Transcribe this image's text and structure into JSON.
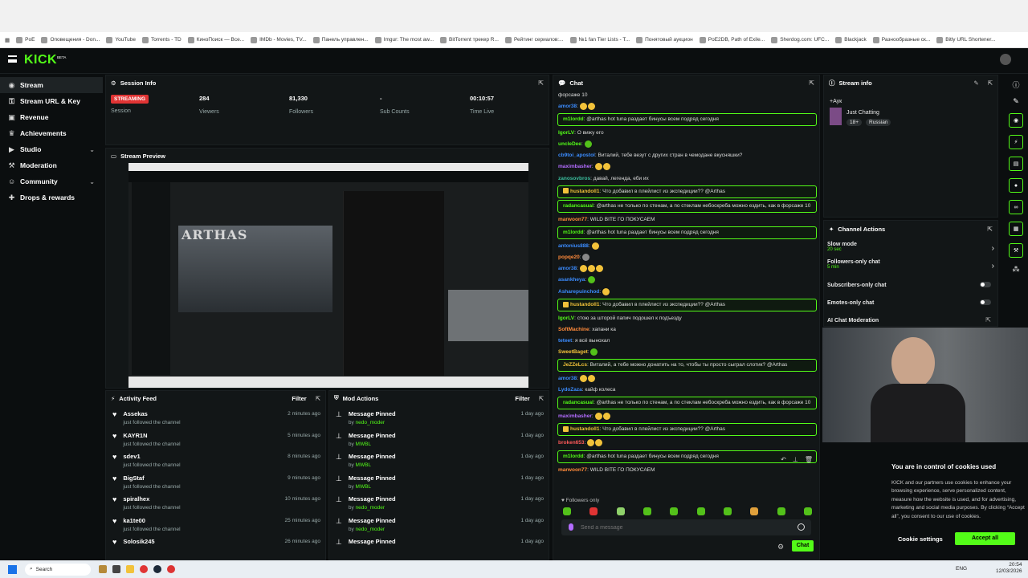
{
  "bookmarks": [
    "PoE",
    "Оповещения - Don...",
    "YouTube",
    "Torrents - TD",
    "КиноПоиск — Все...",
    "IMDb - Movies, TV...",
    "Панель управлен...",
    "Imgur: The most aw...",
    "BitTorrent трекер R...",
    "Рейтинг сериалов:...",
    "№1 fan Tier Lists - T...",
    "Понятовый аукцион",
    "PoE2DB, Path of Exile...",
    "Sherdog.com: UFC...",
    "Blackjack",
    "Разнообразные ск...",
    "Bitly URL Shortener..."
  ],
  "brand": {
    "logo": "KICK",
    "beta": "BETA",
    "accent": "#53fc18"
  },
  "sidebar": {
    "items": [
      {
        "label": "Stream",
        "icon": "broadcast-icon"
      },
      {
        "label": "Stream URL & Key",
        "icon": "key-icon"
      },
      {
        "label": "Revenue",
        "icon": "wallet-icon"
      },
      {
        "label": "Achievements",
        "icon": "trophy-icon"
      },
      {
        "label": "Studio",
        "icon": "studio-icon"
      },
      {
        "label": "Moderation",
        "icon": "wrench-icon"
      },
      {
        "label": "Community",
        "icon": "people-icon"
      },
      {
        "label": "Drops & rewards",
        "icon": "gift-icon"
      }
    ]
  },
  "session": {
    "title": "Session Info",
    "status": "STREAMING",
    "session_label": "Session",
    "viewers": "284",
    "viewers_label": "Viewers",
    "followers": "81,330",
    "followers_label": "Followers",
    "subs": "-",
    "subs_label": "Sub Counts",
    "time": "00:10:57",
    "time_label": "Time Live"
  },
  "preview": {
    "title": "Stream Preview",
    "overlay_text": "ARTHAS"
  },
  "activity": {
    "title": "Activity Feed",
    "filter": "Filter",
    "rows": [
      {
        "name": "Assekas",
        "sub": "just followed the channel",
        "time": "2 minutes ago"
      },
      {
        "name": "KAYR1N",
        "sub": "just followed the channel",
        "time": "5 minutes ago"
      },
      {
        "name": "sdev1",
        "sub": "just followed the channel",
        "time": "8 minutes ago"
      },
      {
        "name": "BigStaf",
        "sub": "just followed the channel",
        "time": "9 minutes ago"
      },
      {
        "name": "spiralhex",
        "sub": "just followed the channel",
        "time": "10 minutes ago"
      },
      {
        "name": "ka1te00",
        "sub": "just followed the channel",
        "time": "25 minutes ago"
      },
      {
        "name": "Solosik245",
        "sub": "",
        "time": "26 minutes ago"
      }
    ]
  },
  "mod": {
    "title": "Mod Actions",
    "filter": "Filter",
    "by": "by",
    "rows": [
      {
        "action": "Message Pinned",
        "by": "nedo_moder",
        "time": "1 day ago"
      },
      {
        "action": "Message Pinned",
        "by": "MWBL",
        "time": "1 day ago"
      },
      {
        "action": "Message Pinned",
        "by": "MWBL",
        "time": "1 day ago"
      },
      {
        "action": "Message Pinned",
        "by": "MWBL",
        "time": "1 day ago"
      },
      {
        "action": "Message Pinned",
        "by": "nedo_moder",
        "time": "1 day ago"
      },
      {
        "action": "Message Pinned",
        "by": "nedo_moder",
        "time": "1 day ago"
      },
      {
        "action": "Message Pinned",
        "by": "",
        "time": "1 day ago"
      }
    ]
  },
  "chat": {
    "title": "Chat",
    "followers_only": "Followers only",
    "placeholder": "Send a message",
    "send": "Chat",
    "messages": [
      {
        "user": "",
        "text": "форсаже 10",
        "color": "#ddd",
        "hl": false
      },
      {
        "user": "amor38",
        "text": "",
        "color": "#3b8cff",
        "hl": false,
        "emotes": 2
      },
      {
        "user": "m1lordd",
        "text": "@arthas hot tuna раздает бинусы всем подряд сегодня",
        "color": "#53fc18",
        "hl": true
      },
      {
        "user": "IgorLV",
        "text": "О вижу его",
        "color": "#53fc18",
        "hl": false
      },
      {
        "user": "uncleDee",
        "text": "",
        "color": "#53fc18",
        "hl": false,
        "emotes": 1,
        "green": true
      },
      {
        "user": "cb9toi_apostol",
        "text": "Виталий, тебе везут с других стран в чемодане вкусняшки?",
        "color": "#3b8cff",
        "hl": false
      },
      {
        "user": "maximbasher",
        "text": "",
        "color": "#b36cff",
        "hl": false,
        "emotes": 2
      },
      {
        "user": "zanosovbros",
        "text": "давай, легенда, еби их",
        "color": "#3bbf9f",
        "hl": false
      },
      {
        "user": "hustandoll1",
        "text": "Что добавил в плейлист из экспедиции?? @Arthas",
        "color": "#f2c23a",
        "hl": true
      },
      {
        "user": "radancasual",
        "text": "@arthas не только по стенам, а по стеклам небоскреба можно ездить, как в форсаже 10",
        "color": "#53fc18",
        "hl": true,
        "two": true
      },
      {
        "user": "marwoon77",
        "text": "WILD BITE ГО ПОКУСАЕМ",
        "color": "#ff8a3b",
        "hl": false
      },
      {
        "user": "m1lordd",
        "text": "@arthas hot tuna раздает бинусы всем подряд сегодня",
        "color": "#53fc18",
        "hl": true
      },
      {
        "user": "antonius888",
        "text": "",
        "color": "#3b8cff",
        "hl": false,
        "emotes": 1
      },
      {
        "user": "popqe20",
        "text": "",
        "color": "#ff8a3b",
        "hl": false,
        "emotes": 1,
        "gray": true
      },
      {
        "user": "amor38",
        "text": "",
        "color": "#3b8cff",
        "hl": false,
        "emotes": 3
      },
      {
        "user": "asankheyа",
        "text": "",
        "color": "#3b8cff",
        "hl": false,
        "emotes": 1,
        "green": true
      },
      {
        "user": "Asharepuinchod",
        "text": "",
        "color": "#3b8cff",
        "hl": false,
        "emotes": 1
      },
      {
        "user": "hustandoll1",
        "text": "Что добавил в плейлист из экспедиции?? @Arthas",
        "color": "#f2c23a",
        "hl": true
      },
      {
        "user": "IgorLV",
        "text": "стою за шторой папич подошел к подъезду",
        "color": "#53fc18",
        "hl": false
      },
      {
        "user": "SoftMachine",
        "text": "хапани ка",
        "color": "#ff8a3b",
        "hl": false
      },
      {
        "user": "teteet",
        "text": "я всё вынохал",
        "color": "#3b8cff",
        "hl": false
      },
      {
        "user": "SweetBaget",
        "text": "",
        "color": "#f2c23a",
        "hl": false,
        "emotes": 1,
        "green": true
      },
      {
        "user": "JeZZeLcs",
        "text": "Виталий, а тебе можно донатить на то, чтобы ты просто сыграл слотик? @Arthas",
        "color": "#f2c23a",
        "hl": true
      },
      {
        "user": "amor38",
        "text": "",
        "color": "#3b8cff",
        "hl": false,
        "emotes": 2
      },
      {
        "user": "LydoZaza",
        "text": "кайф колеса",
        "color": "#3b8cff",
        "hl": false
      },
      {
        "user": "radancasual",
        "text": "@arthas не только по стенам, а по стеклам небоскреба можно ездить, как в форсаже 10",
        "color": "#53fc18",
        "hl": true,
        "two": true
      },
      {
        "user": "maximbasher",
        "text": "",
        "color": "#b36cff",
        "hl": false,
        "emotes": 2
      },
      {
        "user": "hustandoll1",
        "text": "Что добавил в плейлист из экспедиции?? @Arthas",
        "color": "#f2c23a",
        "hl": true
      },
      {
        "user": "broken653",
        "text": "",
        "color": "#ff5a5a",
        "hl": false,
        "emotes": 2
      },
      {
        "user": "m1lordd",
        "text": "@arthas hot tuna раздает бинусы всем подряд сегодня",
        "color": "#53fc18",
        "hl": true
      },
      {
        "user": "marwoon77",
        "text": "WILD BITE ГО ПОКУСАЕМ",
        "color": "#ff8a3b",
        "hl": false
      }
    ]
  },
  "stream_info": {
    "title": "Stream info",
    "stream_title": "+Аук",
    "category": "Just Chatting",
    "age": "18+",
    "language": "Russian"
  },
  "channel_actions": {
    "title": "Channel Actions",
    "slow_mode": "Slow mode",
    "slow_value": "20 sec",
    "followers_only": "Followers-only chat",
    "followers_value": "5 min",
    "subs_only": "Subscribers-only chat",
    "emotes_only": "Emotes-only chat",
    "ai": "AI Chat Moderation"
  },
  "cookies": {
    "title": "You are in control of cookies used",
    "body": "KICK and our partners use cookies to enhance your browsing experience, serve personalized content, measure how the website is used, and for advertising, marketing and social media purposes. By clicking “Accept all”, you consent to our use of cookies.",
    "settings": "Cookie settings",
    "accept": "Accept all"
  },
  "taskbar": {
    "search": "Search",
    "lang": "ENG",
    "time": "20:54",
    "date": "12/03/2026"
  }
}
